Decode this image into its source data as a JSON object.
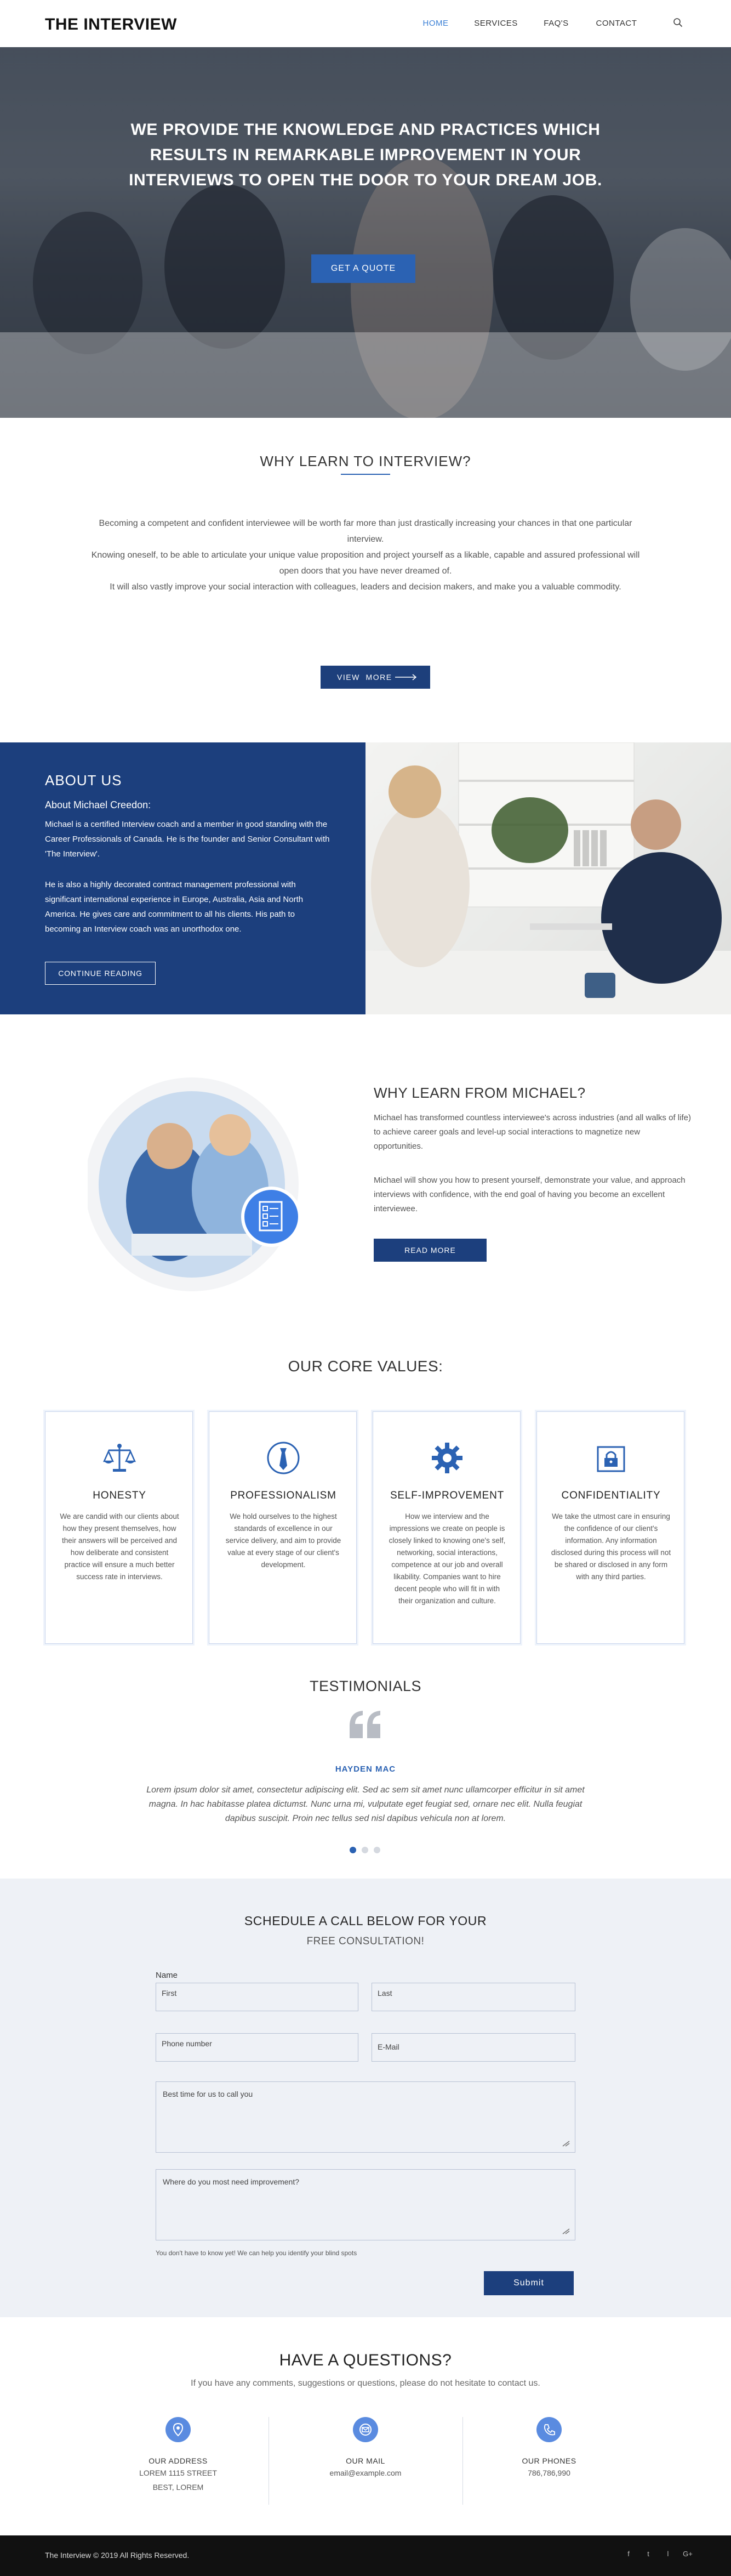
{
  "header": {
    "logo": "THE INTERVIEW",
    "nav": [
      "HOME",
      "SERVICES",
      "FAQ'S",
      "CONTACT"
    ],
    "search_icon": "search-icon"
  },
  "hero": {
    "title": "WE PROVIDE THE KNOWLEDGE AND PRACTICES WHICH RESULTS IN REMARKABLE IMPROVEMENT IN YOUR INTERVIEWS TO OPEN THE DOOR TO YOUR DREAM JOB.",
    "button": "GET A QUOTE"
  },
  "why": {
    "title": "WHY LEARN TO INTERVIEW?",
    "p1": "Becoming a competent and confident interviewee will be worth far more than just drastically increasing your chances in that one particular interview.",
    "p2": "Knowing oneself, to be able to articulate your unique value proposition and project yourself as a likable, capable and assured professional will open doors that you have never dreamed of.",
    "p3": "It will also vastly improve your social interaction with colleagues, leaders and decision makers, and make you a valuable commodity.",
    "button": "VIEW  MORE"
  },
  "about": {
    "heading": "ABOUT US",
    "subheading": "About Michael Creedon:",
    "p1": "Michael is a certified Interview coach and a member in good standing with the Career Professionals of Canada. He is the founder and Senior Consultant with 'The Interview'.",
    "p2": "He is also a highly decorated contract management professional with significant international experience in Europe, Australia, Asia and North America. He gives care and commitment to all his clients. His path to becoming an Interview coach was an unorthodox one.",
    "button": "CONTINUE READING"
  },
  "michael": {
    "title": "WHY LEARN FROM MICHAEL?",
    "p1": "Michael has transformed countless interviewee's across industries (and all walks of life) to achieve career goals and level-up social interactions to magnetize new opportunities.",
    "p2": "Michael will show you how to present yourself, demonstrate your value, and approach interviews with confidence, with the end goal of having you become an excellent interviewee.",
    "button": "READ MORE"
  },
  "core": {
    "title": "OUR CORE VALUES:",
    "cards": [
      {
        "title": "HONESTY",
        "text": "We are candid with our clients about how they present themselves, how their answers will be perceived and how deliberate and consistent practice will ensure a much better success rate in interviews.",
        "icon": "scales-icon"
      },
      {
        "title": "PROFESSIONALISM",
        "text": "We hold ourselves to the highest standards of excellence in our service delivery, and aim to provide value at every stage of our client's development.",
        "icon": "tie-icon"
      },
      {
        "title": "SELF-IMPROVEMENT",
        "text": "How we interview and the impressions we create on people is closely linked to knowing one's self, networking, social interactions, competence at our job and overall likability. Companies want to hire decent people who will fit in with their organization and culture.",
        "icon": "gear-icon"
      },
      {
        "title": "CONFIDENTIALITY",
        "text": "We take the utmost care in ensuring the confidence of our client's information. Any information disclosed during this process will not be shared or disclosed in any form with any third parties.",
        "icon": "lock-document-icon"
      }
    ]
  },
  "testimonials": {
    "title": "TESTIMONIALS",
    "name": "HAYDEN MAC",
    "text": "Lorem ipsum dolor sit amet, consectetur adipiscing elit. Sed ac sem sit amet nunc ullamcorper efficitur in sit amet magna. In hac habitasse platea dictumst. Nunc urna mi, vulputate eget feugiat sed, ornare nec elit. Nulla feugiat dapibus suscipit. Proin nec tellus sed nisl dapibus vehicula non at lorem.",
    "active_slide": 1,
    "slides": 3
  },
  "schedule": {
    "title": "SCHEDULE A CALL BELOW FOR YOUR",
    "subtitle": "FREE CONSULTATION!",
    "name_label": "Name",
    "first": "First",
    "last": "Last",
    "phone": "Phone number",
    "email": "E-Mail",
    "best_time": "Best time for us to call you",
    "improvement": "Where do you most need improvement?",
    "hint": "You don't have to know yet! We can help you identify your blind spots",
    "submit": "Submit"
  },
  "questions": {
    "title": "HAVE A QUESTIONS?",
    "subtitle": "If you have any comments, suggestions or questions, please do not hesitate to contact us.",
    "address_label": "OUR ADDRESS",
    "address_line1": "LOREM 1115 STREET",
    "address_line2": "BEST, LOREM",
    "mail_label": "OUR MAIL",
    "mail_value": "email@example.com",
    "phone_label": "OUR PHONES",
    "phone_value": "786,786,990"
  },
  "footer": {
    "copyright": "The Interview © 2019 All Rights Reserved.",
    "social": [
      "f",
      "t",
      "l",
      "G+"
    ]
  },
  "colors": {
    "accent": "#2b62b3",
    "navy": "#1c3f7d",
    "light_bg": "#eef1f6"
  }
}
